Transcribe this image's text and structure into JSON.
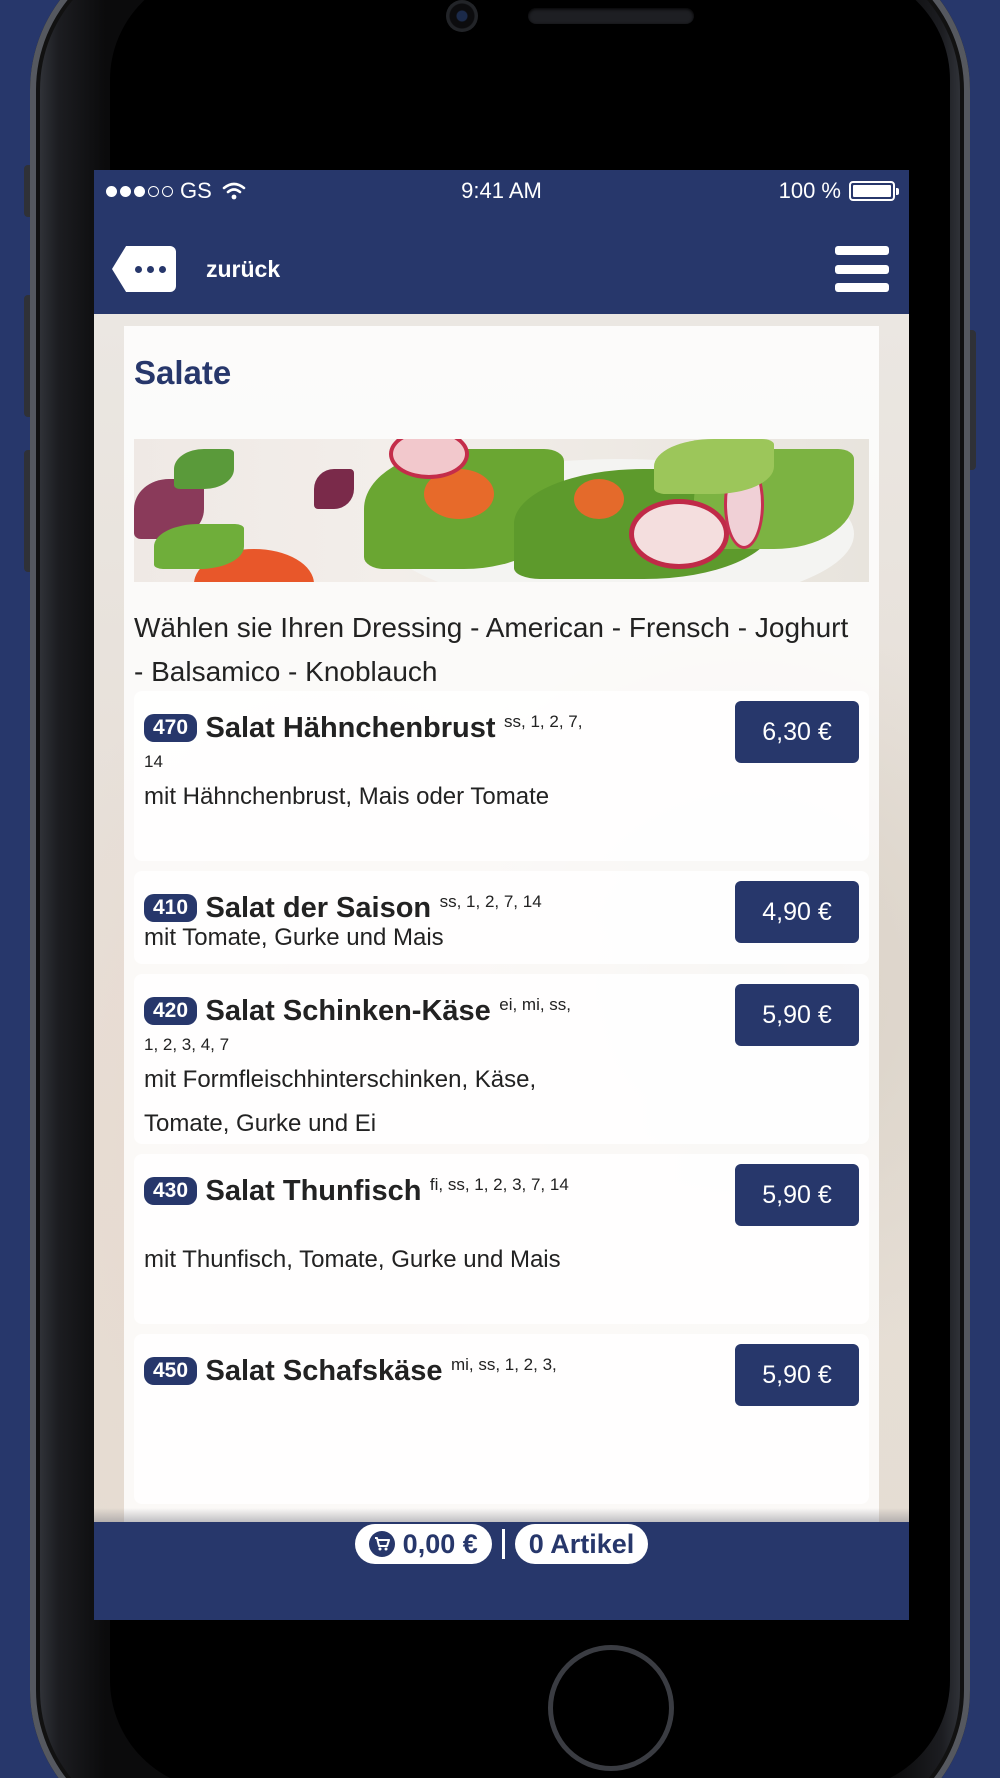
{
  "status_bar": {
    "carrier": "GS",
    "signal_dots_filled": 3,
    "signal_dots_total": 5,
    "time": "9:41 AM",
    "battery": "100 %"
  },
  "nav": {
    "back_label": "zurück"
  },
  "page": {
    "title": "Salate",
    "intro": "Wählen sie Ihren Dressing - American - Frensch - Joghurt - Balsamico - Knoblauch"
  },
  "items": [
    {
      "number": "470",
      "name": "Salat Hähnchenbrust",
      "allergens": "ss, 1, 2, 7, 14",
      "description": "mit Hähnchenbrust, Mais oder Tomate",
      "price": "6,30 €"
    },
    {
      "number": "410",
      "name": "Salat der Saison",
      "allergens": "ss, 1, 2, 7, 14",
      "description": "mit Tomate, Gurke und Mais",
      "price": "4,90 €"
    },
    {
      "number": "420",
      "name": "Salat Schinken-Käse",
      "allergens": "ei, mi, ss, 1, 2, 3, 4, 7",
      "description": "mit Formfleischhinterschinken, Käse, Tomate, Gurke und Ei",
      "price": "5,90 €"
    },
    {
      "number": "430",
      "name": "Salat Thunfisch",
      "allergens": "fi, ss, 1, 2, 3, 7, 14",
      "description": "mit Thunfisch, Tomate, Gurke und Mais",
      "price": "5,90 €"
    },
    {
      "number": "450",
      "name": "Salat Schafskäse",
      "allergens": "mi, ss, 1, 2, 3,",
      "description": "",
      "price": "5,90 €"
    }
  ],
  "cart": {
    "total": "0,00 €",
    "count": "0 Artikel"
  },
  "colors": {
    "brand": "#27376b",
    "background": "#27376b"
  }
}
